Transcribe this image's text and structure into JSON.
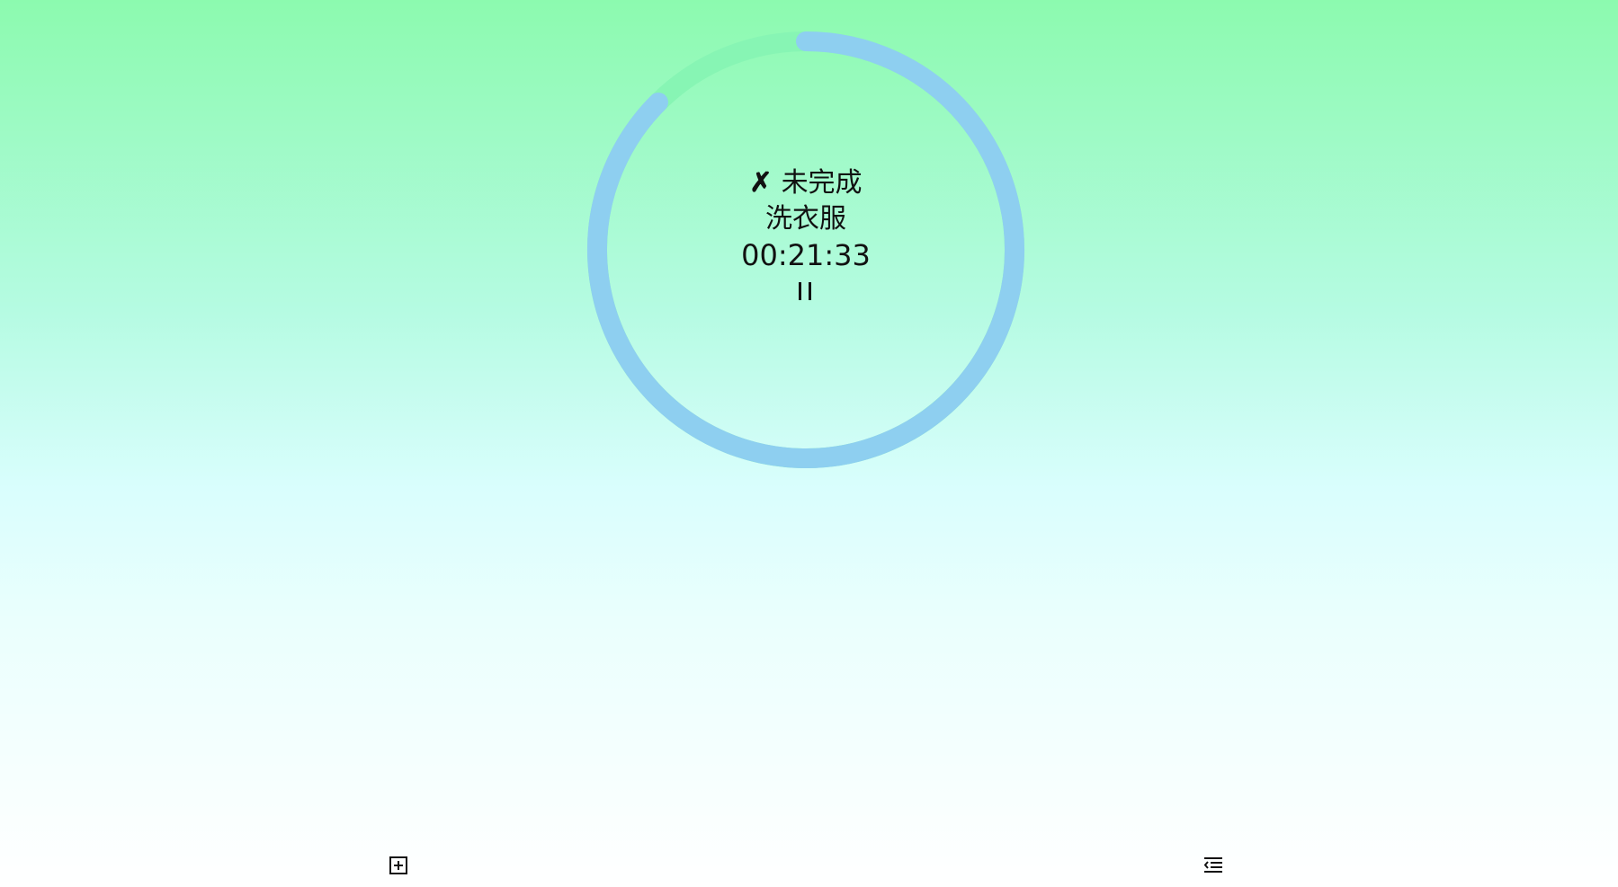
{
  "timer": {
    "status_icon": "✗",
    "status_label": "未完成",
    "task_name": "洗衣服",
    "time": "00:21:33",
    "progress_fraction": 0.125,
    "colors": {
      "ring": "#8ecff0",
      "ring_gap": "#87f5b4"
    }
  },
  "controls": {
    "pause_icon": "pause-icon"
  },
  "bottom_bar": {
    "add_icon": "add-box-icon",
    "list_icon": "list-indent-icon"
  }
}
